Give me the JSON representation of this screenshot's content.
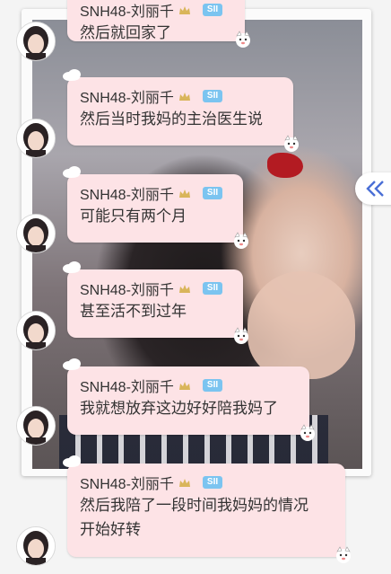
{
  "sender": {
    "name": "SNH48-刘丽千",
    "tier_badge": "SII"
  },
  "messages": [
    {
      "text": "然后就回家了"
    },
    {
      "text": "然后当时我妈的主治医生说"
    },
    {
      "text": "可能只有两个月"
    },
    {
      "text": "甚至活不到过年"
    },
    {
      "text": "我就想放弃这边好好陪我妈了"
    },
    {
      "text": "然后我陪了一段时间我妈妈的情况\n开始好转"
    }
  ],
  "colors": {
    "bubble": "#fde3e6",
    "badge": "#7bc4f0",
    "arrow": "#4a6fd6"
  },
  "icons": {
    "back": "double-chevron-left-icon",
    "crown": "crown-icon",
    "cloud": "cloud-icon",
    "cat": "cat-sticker-icon"
  }
}
